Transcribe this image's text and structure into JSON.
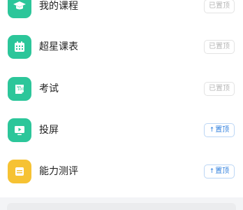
{
  "items": [
    {
      "label": "我的课程",
      "icon": "graduation-cap-icon",
      "icon_color": "#2cc69a",
      "pin_state": "pinned",
      "pin_label": "已置顶"
    },
    {
      "label": "超星课表",
      "icon": "calendar-icon",
      "icon_color": "#2cc69a",
      "pin_state": "pinned",
      "pin_label": "已置顶"
    },
    {
      "label": "考试",
      "icon": "exam-paper-icon",
      "icon_color": "#2cc69a",
      "pin_state": "pinned",
      "pin_label": "已置顶"
    },
    {
      "label": "投屏",
      "icon": "screen-cast-icon",
      "icon_color": "#2cc69a",
      "pin_state": "unpinned",
      "pin_label": "置顶",
      "pin_arrow": "↑"
    },
    {
      "label": "能力测评",
      "icon": "assessment-icon",
      "icon_color": "#f6c233",
      "pin_state": "unpinned",
      "pin_label": "置顶",
      "pin_arrow": "↑"
    }
  ],
  "colors": {
    "accent_blue": "#2f7fde",
    "pinned_gray": "#b5b5b5",
    "background": "#ffffff"
  }
}
